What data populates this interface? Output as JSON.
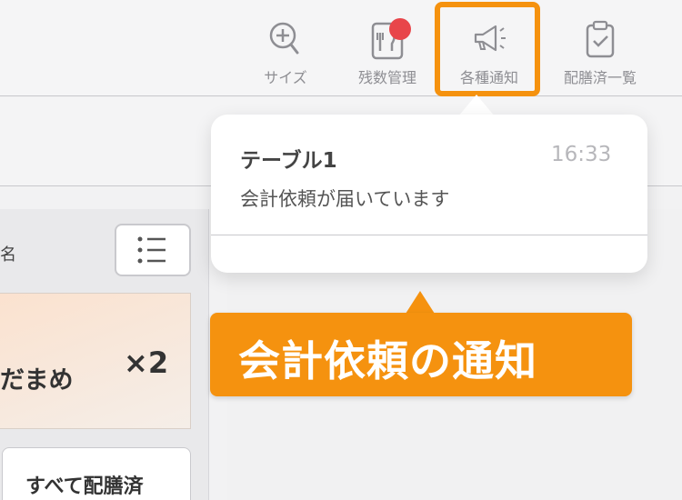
{
  "toolbar": {
    "size_label": "サイズ",
    "stock_label": "残数管理",
    "notify_label": "各種通知",
    "served_label": "配膳済一覧",
    "badge_color": "#e8454a",
    "highlight_color": "#f5920f"
  },
  "left_panel": {
    "header_fragment": "名",
    "order": {
      "name_fragment": "だまめ",
      "quantity": "×2"
    },
    "serve_all_label": "すべて配膳済"
  },
  "notification": {
    "table": "テーブル1",
    "time": "16:33",
    "message": "会計依頼が届いています"
  },
  "callout": {
    "text": "会計依頼の通知",
    "color": "#f5920f"
  },
  "icons": [
    "zoom-in-icon",
    "stock-menu-icon",
    "megaphone-icon",
    "clipboard-check-icon",
    "list-icon"
  ]
}
